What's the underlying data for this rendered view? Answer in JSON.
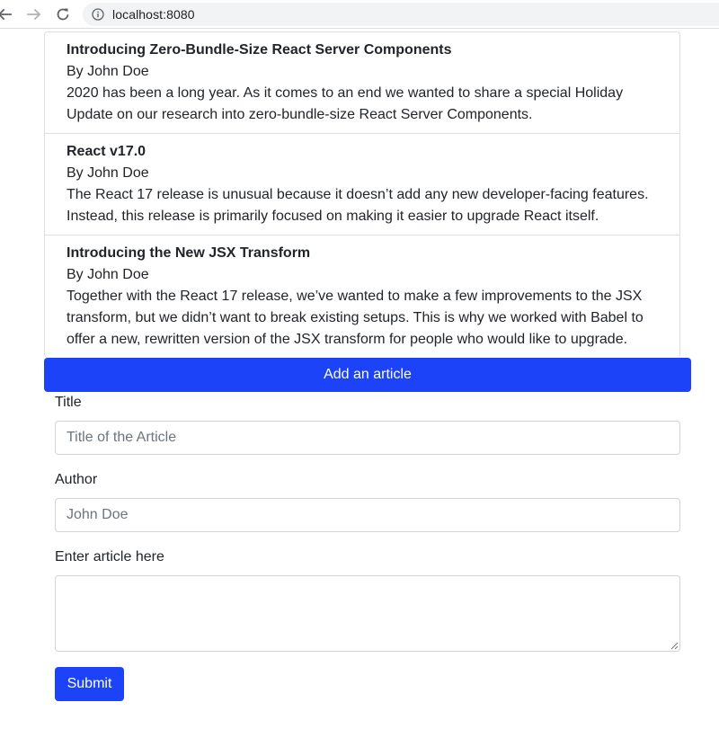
{
  "browser": {
    "url": "localhost:8080",
    "icons": {
      "back": "arrow-left-icon",
      "forward": "arrow-right-icon",
      "reload": "reload-icon",
      "info": "info-icon"
    }
  },
  "articles": [
    {
      "title": "Introducing Zero-Bundle-Size React Server Components",
      "author": "By John Doe",
      "body": "2020 has been a long year. As it comes to an end we wanted to share a special Holiday Update on our research into zero-bundle-size React Server Components."
    },
    {
      "title": "React v17.0",
      "author": "By John Doe",
      "body": "The React 17 release is unusual because it doesn’t add any new developer-facing features. Instead, this release is primarily focused on making it easier to upgrade React itself."
    },
    {
      "title": "Introducing the New JSX Transform",
      "author": "By John Doe",
      "body": "Together with the React 17 release, we’ve wanted to make a few improvements to the JSX transform, but we didn’t want to break existing setups. This is why we worked with Babel to offer a new, rewritten version of the JSX transform for people who would like to upgrade."
    }
  ],
  "add_button_label": "Add an article",
  "form": {
    "title_label": "Title",
    "title_placeholder": "Title of the Article",
    "author_label": "Author",
    "author_placeholder": "John Doe",
    "article_label": "Enter article here",
    "article_value": "",
    "submit_label": "Submit"
  },
  "colors": {
    "primary": "#1c43f7",
    "border": "#ced4da",
    "text": "#212529",
    "placeholder": "#6c757d"
  }
}
